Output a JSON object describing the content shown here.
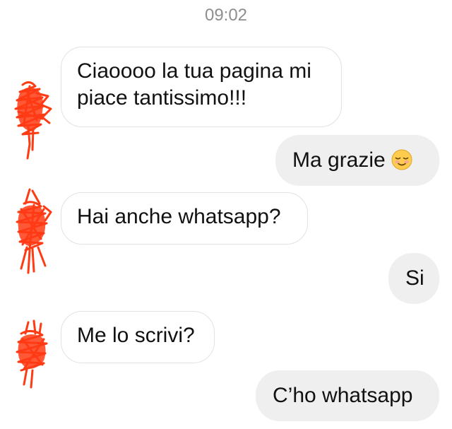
{
  "chat": {
    "timestamp": "09:02",
    "messages": [
      {
        "id": "m1",
        "direction": "incoming",
        "lines": [
          "Ciaoooo la tua pagina mi",
          "piace tantissimo!!!"
        ]
      },
      {
        "id": "m2",
        "direction": "outgoing",
        "text": "Ma grazie",
        "emoji": "relieved-smiling-face-emoji"
      },
      {
        "id": "m3",
        "direction": "incoming",
        "text": "Hai anche whatsapp?"
      },
      {
        "id": "m4",
        "direction": "outgoing",
        "text": "Si"
      },
      {
        "id": "m5",
        "direction": "incoming",
        "text": "Me lo scrivi?"
      },
      {
        "id": "m6",
        "direction": "outgoing",
        "text": "C’ho whatsapp"
      }
    ]
  },
  "colors": {
    "incoming_bubble_border": "#e2e2e2",
    "outgoing_bubble_bg": "#efefef",
    "timestamp_text": "#8e8e8e",
    "avatar_scribble": "#ff3b14"
  },
  "icons": {
    "avatar": "redacted-avatar-scribble",
    "emoji": "relieved-smiling-face-emoji"
  }
}
